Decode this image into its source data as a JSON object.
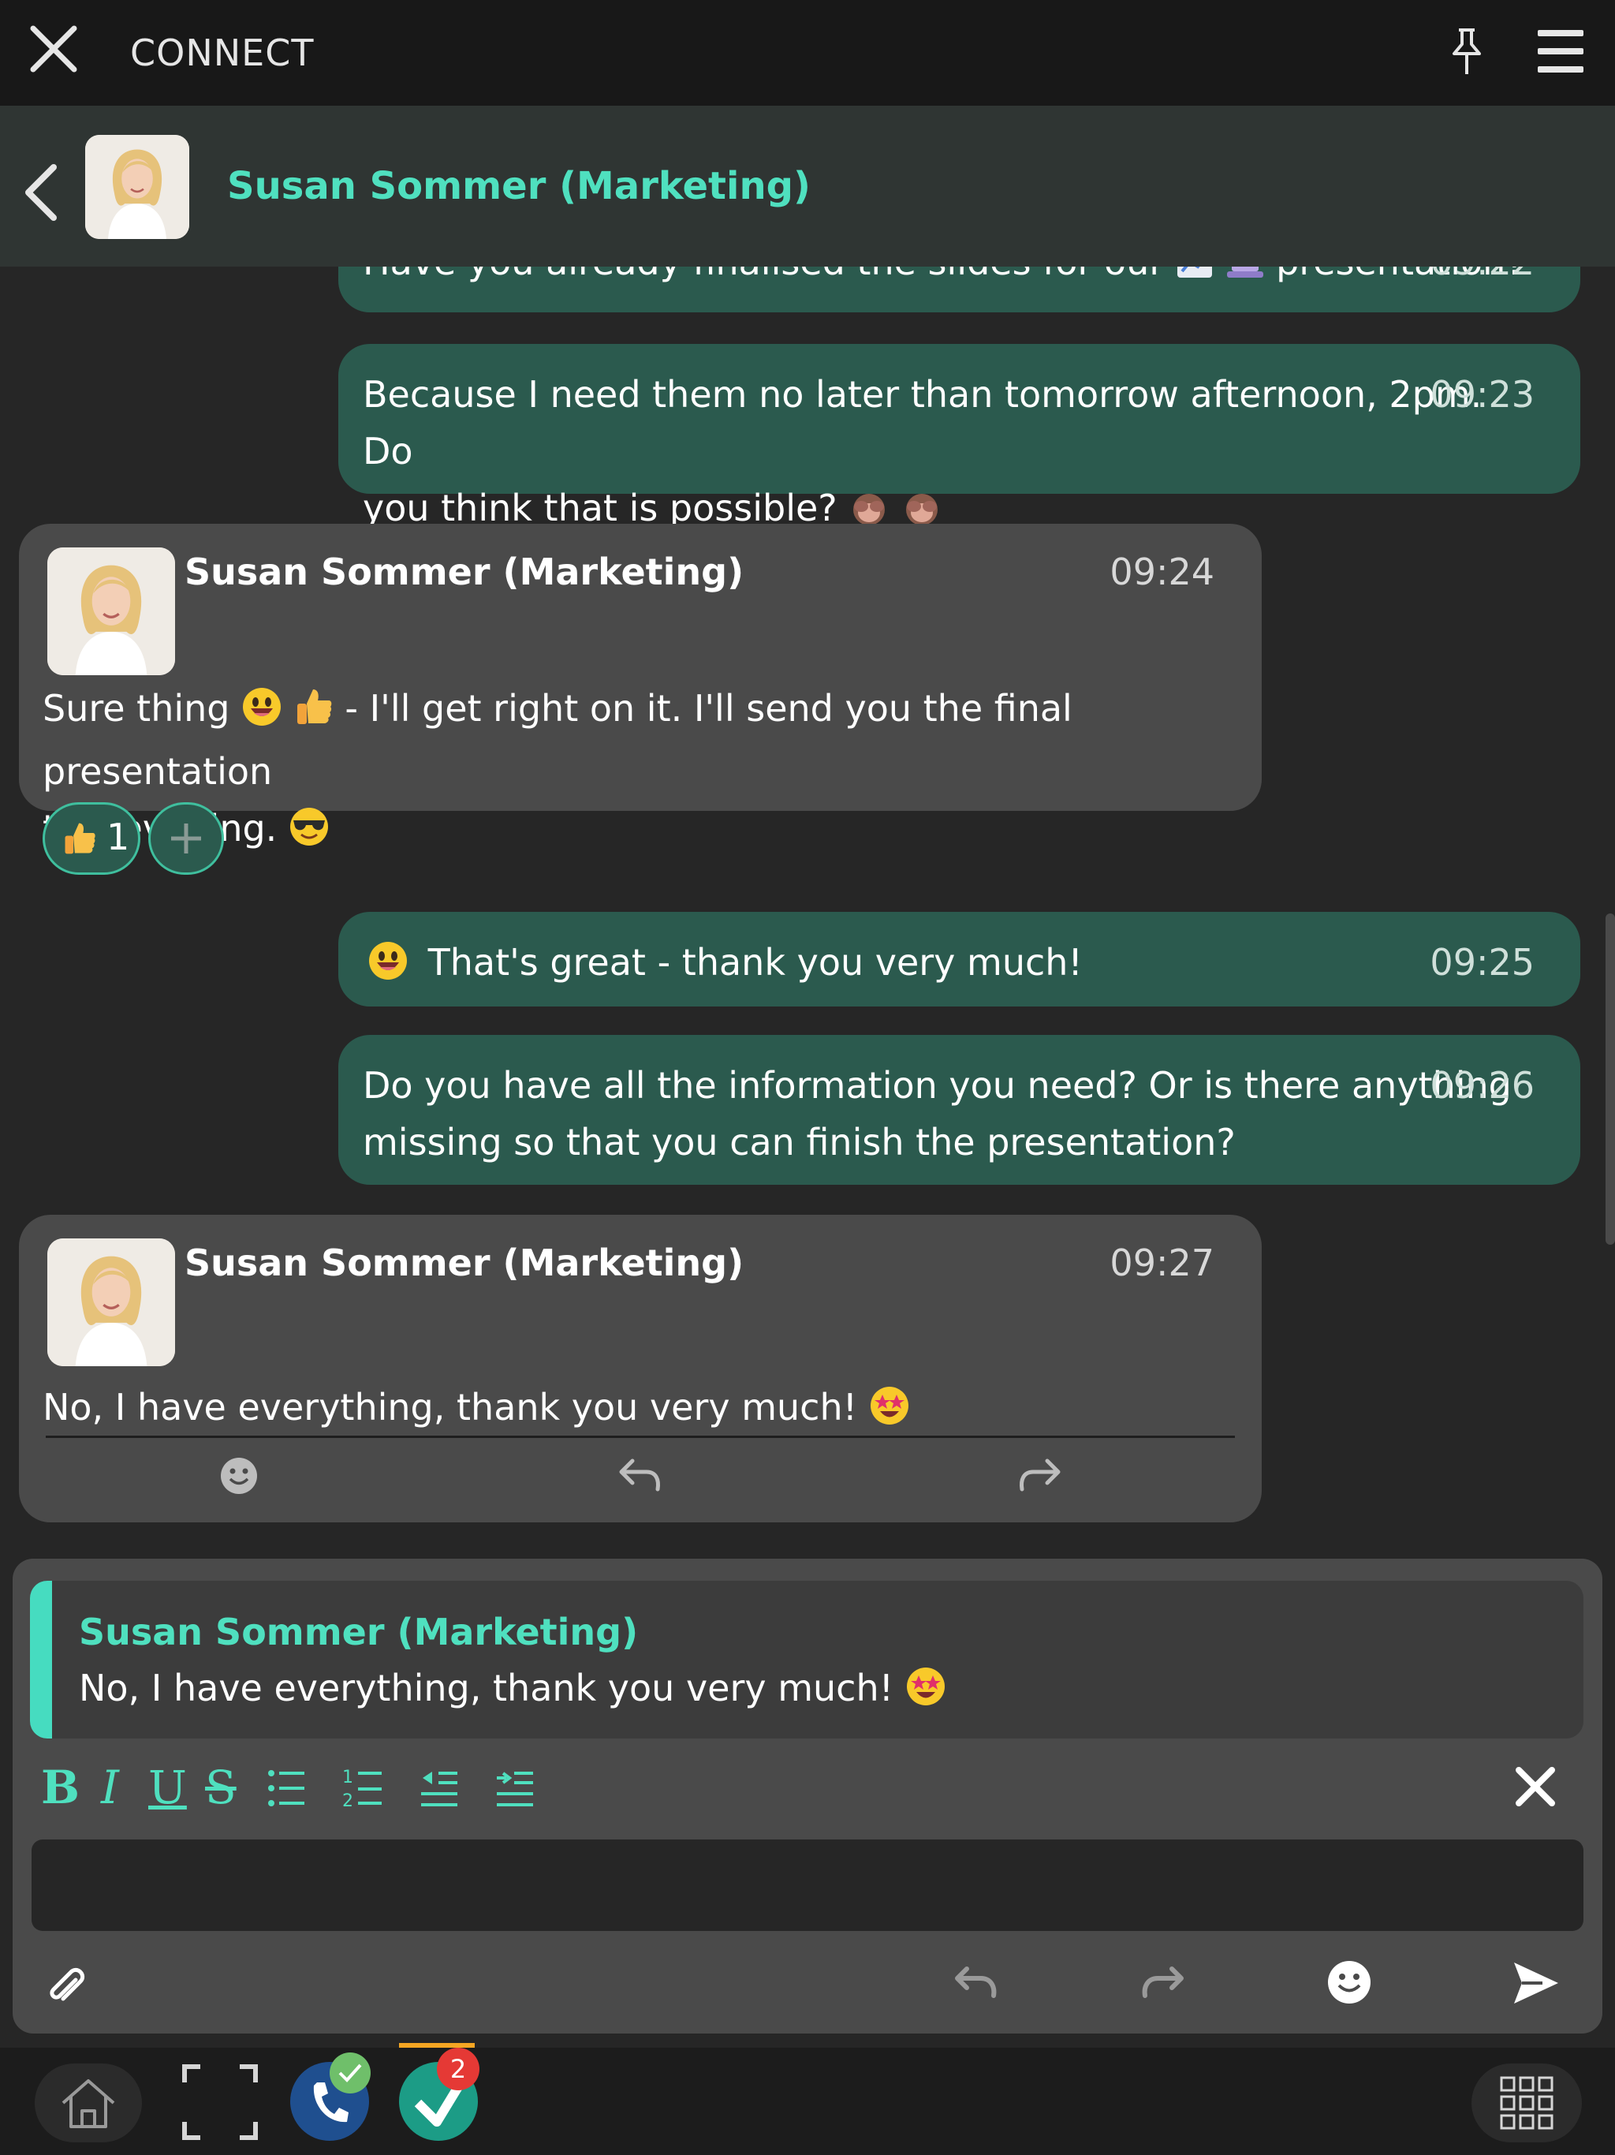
{
  "app": {
    "title": "CONNECT"
  },
  "contact": {
    "name": "Susan Sommer (Marketing)"
  },
  "messages": {
    "m1": {
      "text": "Have you already finalised the slides for our",
      "text_after": "presentation?",
      "time": "09:22"
    },
    "m2": {
      "line1": "Because I need them no later than tomorrow afternoon, 2pm. Do",
      "line2": "you think that is possible?",
      "time": "09:23"
    },
    "m3": {
      "name": "Susan Sommer (Marketing)",
      "time": "09:24",
      "line1_a": "Sure thing",
      "line1_b": "- I'll get right on it. I'll send you the final presentation",
      "line2": "this evening.",
      "reaction_count": "1"
    },
    "m4": {
      "text": "That's great - thank you very much!",
      "time": "09:25"
    },
    "m5": {
      "line1": "Do you have all the information you need? Or is there anything",
      "line2": "missing  so that you can finish the presentation?",
      "time": "09:26"
    },
    "m6": {
      "name": "Susan Sommer (Marketing)",
      "time": "09:27",
      "text": "No, I have everything, thank you very much!"
    }
  },
  "composer": {
    "quote_name": "Susan Sommer (Marketing)",
    "quote_text": "No, I have everything, thank you very much!",
    "format": {
      "bold": "B",
      "italic": "I",
      "underline": "U",
      "strike": "S"
    },
    "input_value": ""
  },
  "taskbar": {
    "chat_badge": "2"
  },
  "colors": {
    "accent": "#4fe0bf",
    "outgoing": "#2b5a4e",
    "incoming": "#4a4a4a",
    "badge": "#e53935"
  }
}
